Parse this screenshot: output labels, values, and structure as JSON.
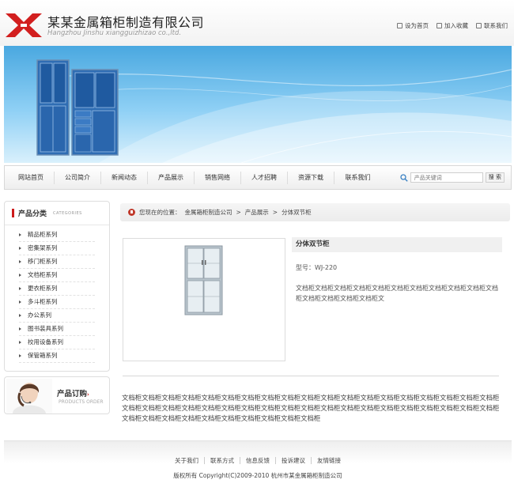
{
  "header": {
    "company_name": "某某金属箱柜制造有限公司",
    "company_pinyin": "Hangzhou Jinshu xiangguizhizao co.,ltd.",
    "links": [
      {
        "label": "设为首页",
        "icon": "home-icon"
      },
      {
        "label": "加入收藏",
        "icon": "bookmark-icon"
      },
      {
        "label": "联系我们",
        "icon": "contact-icon"
      }
    ]
  },
  "nav": {
    "items": [
      "网站首页",
      "公司简介",
      "新闻动态",
      "产品展示",
      "销售网络",
      "人才招聘",
      "资源下载",
      "联系我们"
    ],
    "search_placeholder": "产品关键词",
    "search_button": "搜 索"
  },
  "sidebar": {
    "title": "产品分类",
    "subtitle": "CATEGORIES",
    "items": [
      "精品柜系列",
      "密集架系列",
      "移门柜系列",
      "文档柜系列",
      "更衣柜系列",
      "多斗柜系列",
      "办公系列",
      "图书装具系列",
      "校用设备系列",
      "保管箱系列"
    ]
  },
  "order": {
    "title": "产品订购",
    "arrow": "›",
    "subtitle": "PRODUCTS ORDER"
  },
  "breadcrumb": {
    "prefix": "您现在的位置：",
    "home": "金属箱柜制造公司",
    "sep1": " > ",
    "section": "产品展示",
    "sep2": " > ",
    "current": "分体双节柜"
  },
  "product": {
    "title": "分体双节柜",
    "model": "型号：WJ-220",
    "description": "文档柜文档柜文档柜文档柜文档柜文档柜文档柜文档柜文档柜文档柜文档柜文档柜文档柜文档柜文档柜文",
    "details": "文档柜文档柜文档柜文档柜文档柜文档柜文档柜文档柜文档柜文档柜文档柜文档柜文档柜文档柜文档柜文档柜文档柜文档柜文档柜文档柜文档柜文档柜文档柜文档柜文档柜文档柜文档柜文档柜文档柜文档柜文档柜文档柜文档柜文档柜文档柜文档柜文档柜文档柜文档柜文档柜文档柜文档柜文档柜文档柜文档柜文档柜文档柜文档柜"
  },
  "footer": {
    "links": [
      "关于我们",
      "联系方式",
      "信息反馈",
      "投诉建议",
      "友情链接"
    ],
    "copyright": "版权所有  Copyright(C)2009-2010 杭州市某金属箱柜制造公司"
  },
  "colors": {
    "brand_red": "#cc1a1a",
    "banner_blue": "#4aa8e0",
    "cabinet_blue": "#2f6db3"
  }
}
